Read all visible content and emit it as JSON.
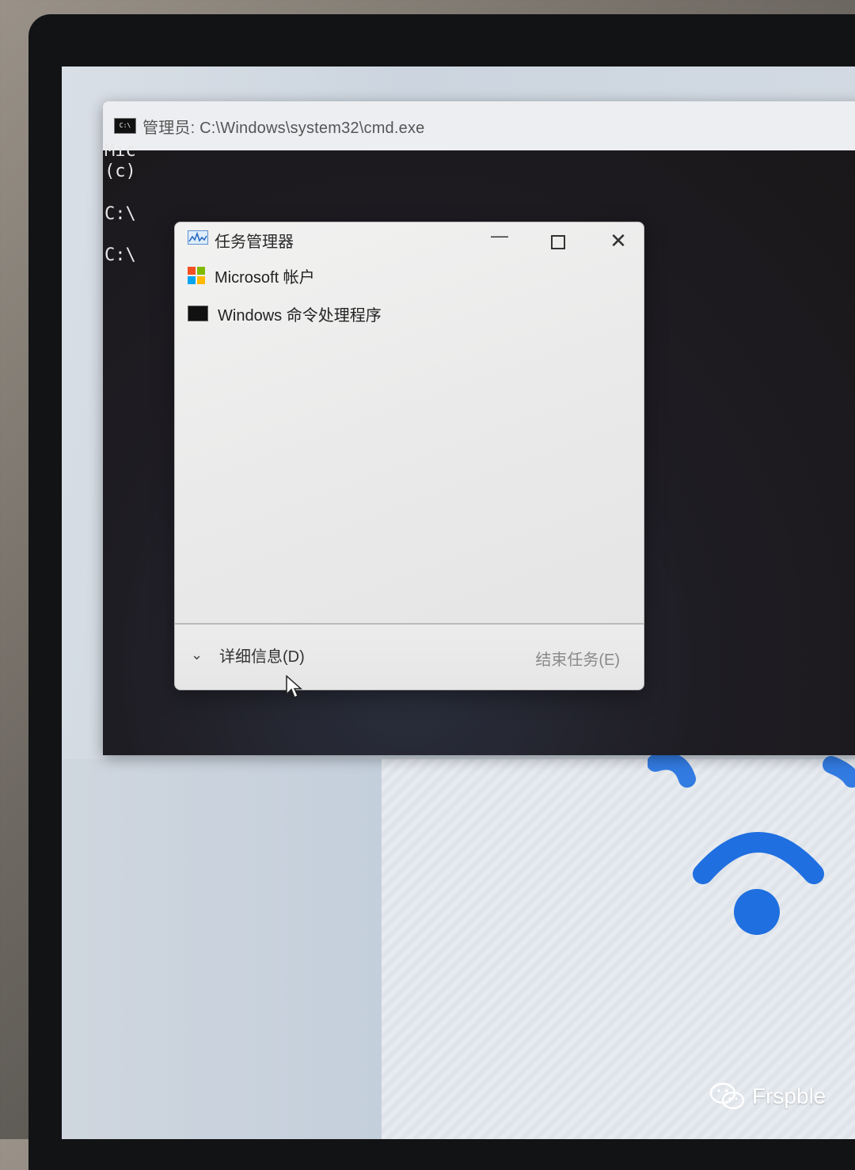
{
  "cmd_window": {
    "title": "管理员: C:\\Windows\\system32\\cmd.exe",
    "icon_label": "C:\\",
    "lines": [
      "Mic",
      "(c)",
      "C:\\",
      "C:\\"
    ]
  },
  "task_manager": {
    "title": "任务管理器",
    "controls": {
      "minimize": "—",
      "close": "✕"
    },
    "processes": [
      {
        "label": "Microsoft 帐户",
        "icon": "microsoft-logo-icon"
      },
      {
        "label": "Windows 命令处理程序",
        "icon": "cmd-icon"
      }
    ],
    "details_label": "详细信息(D)",
    "end_task_label": "结束任务(E)"
  },
  "watermark": {
    "text": "Frspble"
  },
  "colors": {
    "wifi_blue": "#1f6fe0",
    "cmd_background": "#1c1a1f",
    "ms_red": "#f25022",
    "ms_green": "#7fba00",
    "ms_blue": "#00a4ef",
    "ms_yellow": "#ffb900"
  }
}
